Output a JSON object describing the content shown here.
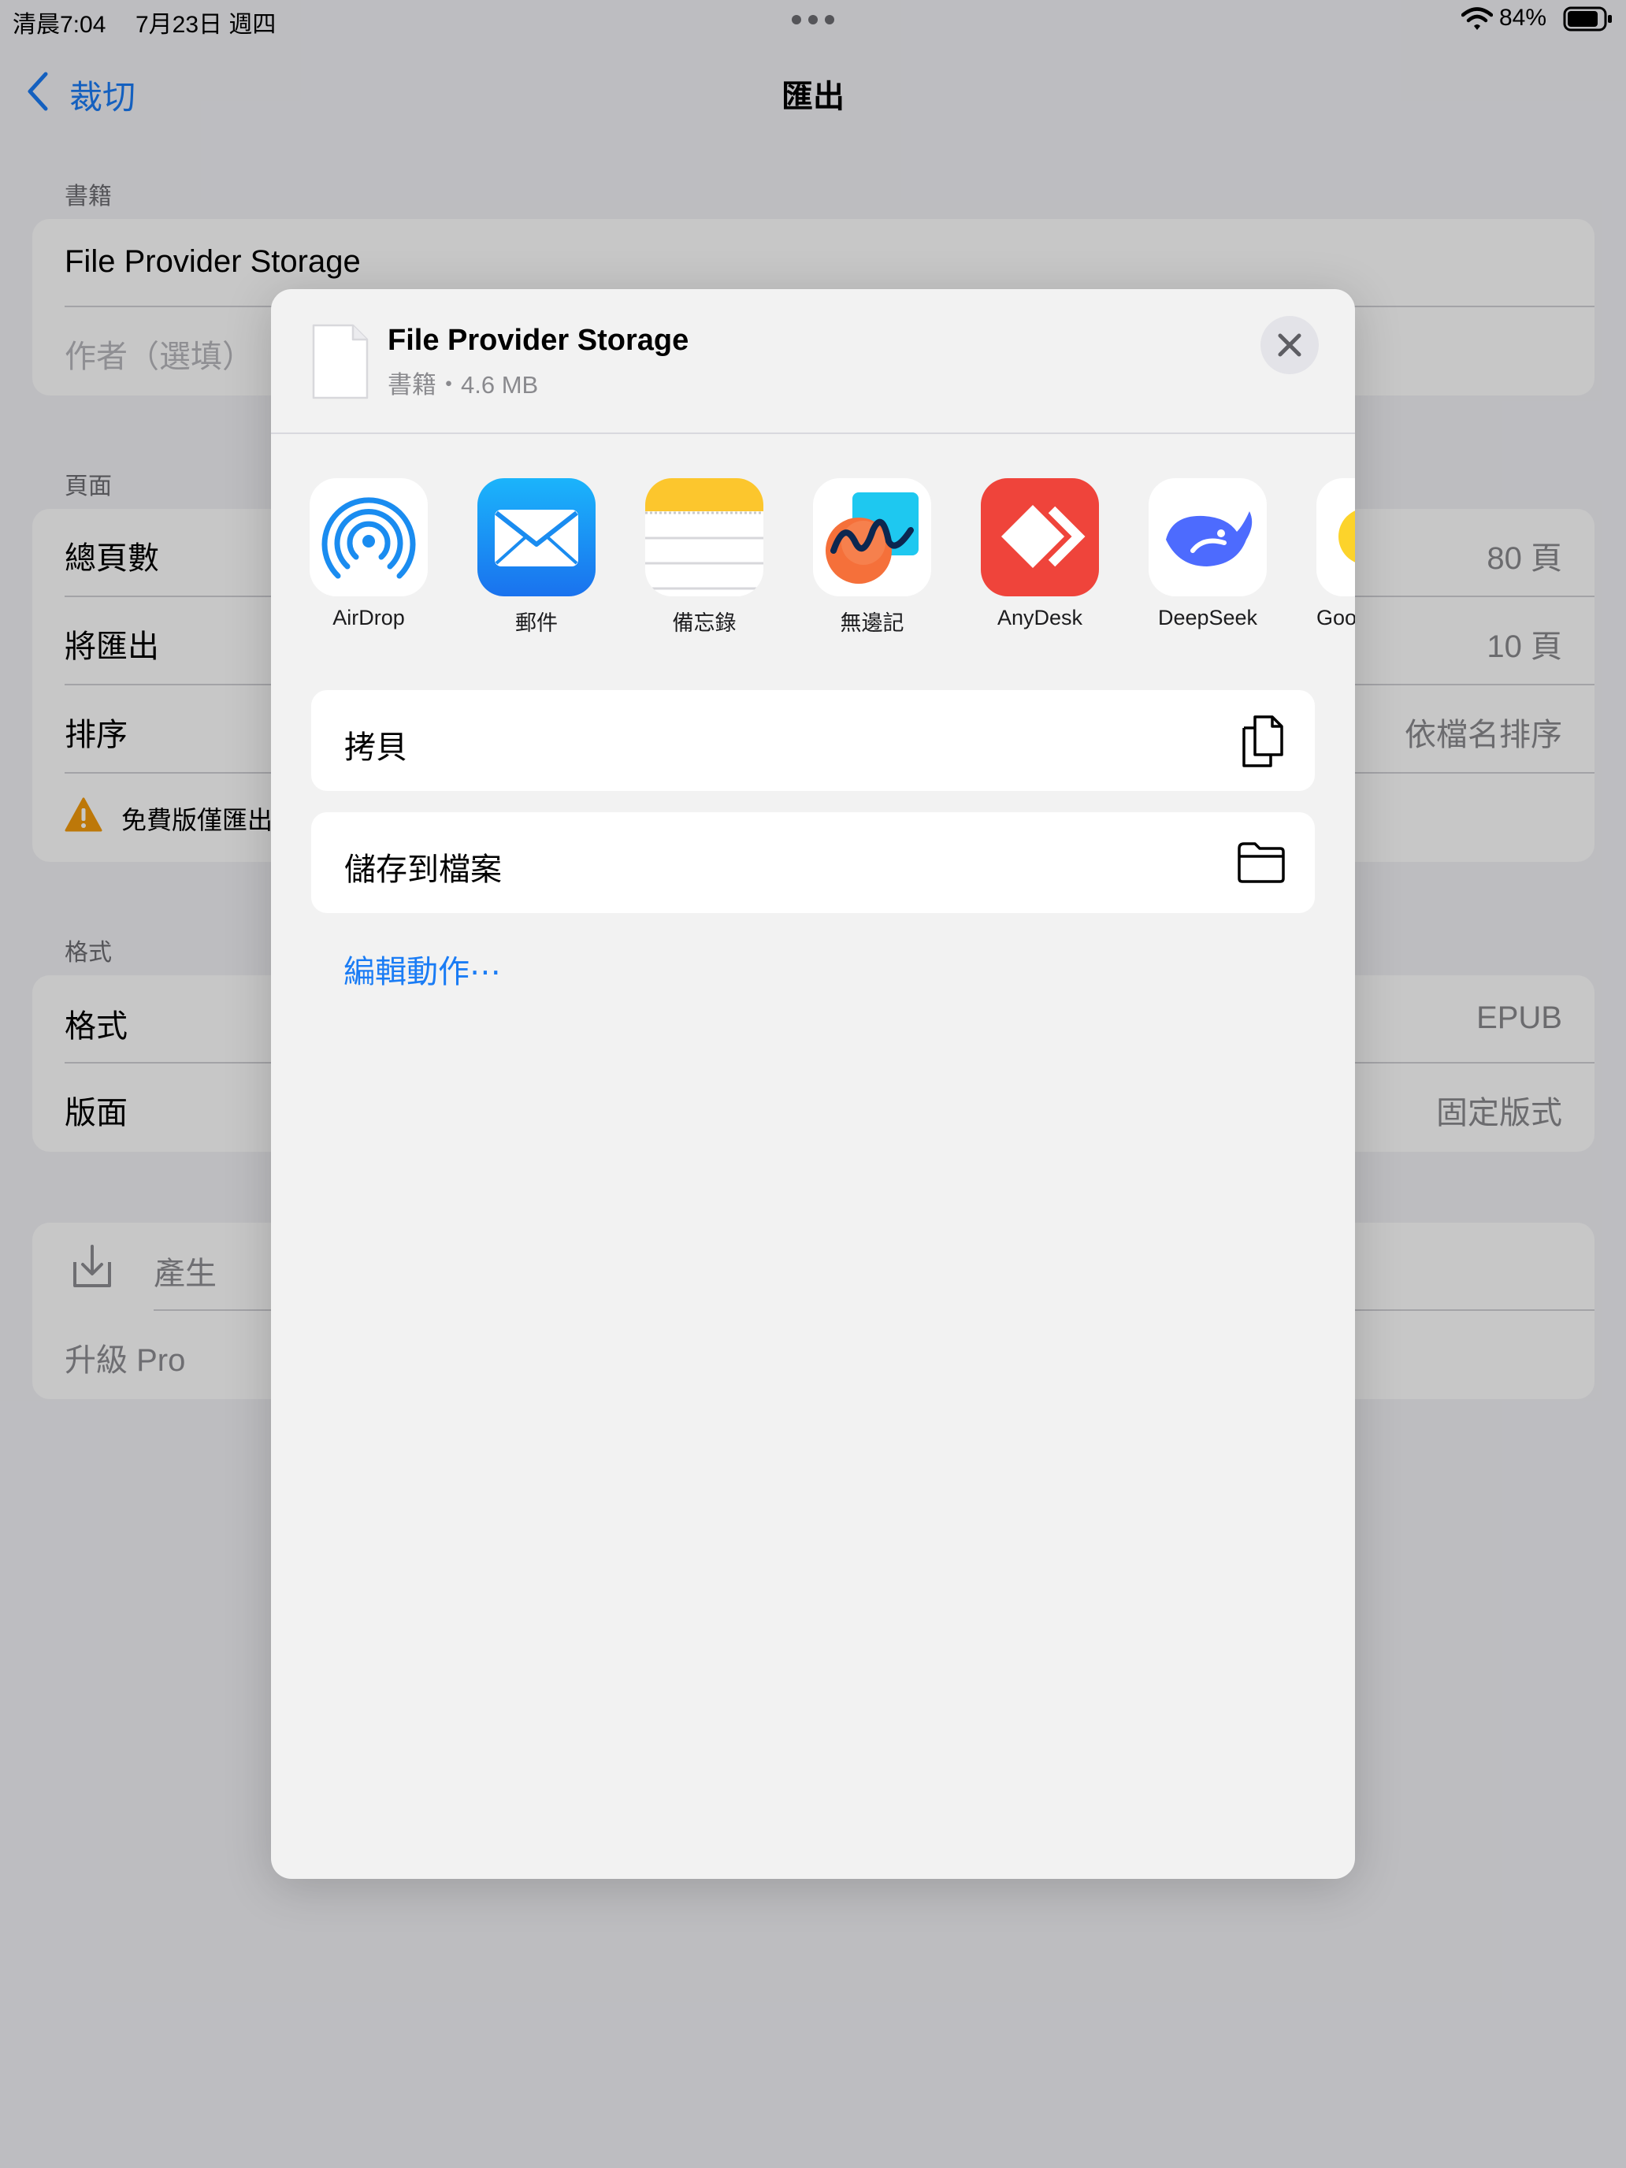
{
  "status_bar": {
    "time": "清晨7:04",
    "date": "7月23日 週四",
    "battery_pct": "84%"
  },
  "nav": {
    "back_label": "裁切",
    "title": "匯出"
  },
  "book_section": {
    "header": "書籍",
    "title_value": "File Provider Storage",
    "author_placeholder": "作者（選填）"
  },
  "pages_section": {
    "header": "頁面",
    "rows": [
      {
        "label": "總頁數",
        "value": "80 頁"
      },
      {
        "label": "將匯出",
        "value": "10 頁"
      },
      {
        "label": "排序",
        "value": "依檔名排序"
      }
    ],
    "warning": "免費版僅匯出"
  },
  "format_section": {
    "header": "格式",
    "rows": [
      {
        "label": "格式",
        "value": "EPUB"
      },
      {
        "label": "版面",
        "value": "固定版式"
      }
    ]
  },
  "generate_section": {
    "generate_label": "產生",
    "upgrade_label": "升級 Pro"
  },
  "share_sheet": {
    "file_name": "File Provider Storage",
    "file_meta": "書籍・4.6 MB",
    "apps": [
      {
        "label": "AirDrop",
        "icon": "airdrop-icon"
      },
      {
        "label": "郵件",
        "icon": "mail-icon"
      },
      {
        "label": "備忘錄",
        "icon": "notes-icon"
      },
      {
        "label": "無邊記",
        "icon": "freeform-icon"
      },
      {
        "label": "AnyDesk",
        "icon": "anydesk-icon"
      },
      {
        "label": "DeepSeek",
        "icon": "deepseek-icon"
      },
      {
        "label": "Goog",
        "icon": "google-icon"
      }
    ],
    "actions": [
      {
        "label": "拷貝",
        "icon": "copy-icon"
      },
      {
        "label": "儲存到檔案",
        "icon": "folder-icon"
      }
    ],
    "edit_actions": "編輯動作⋯"
  },
  "colors": {
    "accent": "#1a7cf5",
    "warning": "#f29a0c",
    "anydesk": "#ef443b",
    "deepseek": "#4d6bfe"
  }
}
